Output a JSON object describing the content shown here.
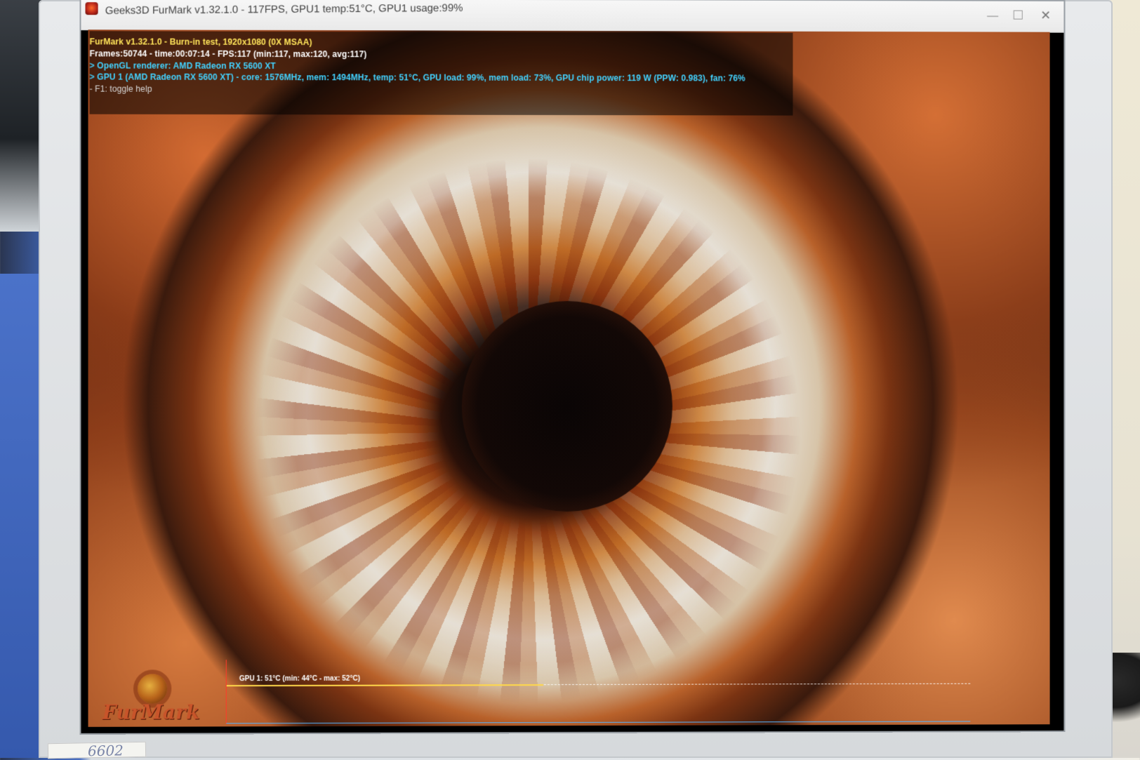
{
  "window": {
    "title": "Geeks3D FurMark v1.32.1.0 - 117FPS, GPU1 temp:51°C, GPU1 usage:99%",
    "minimize_glyph": "—",
    "maximize_glyph": "☐",
    "close_glyph": "✕"
  },
  "hud": {
    "line1": "FurMark v1.32.1.0 - Burn-in test, 1920x1080 (0X MSAA)",
    "line2": "Frames:50744 - time:00:07:14 - FPS:117 (min:117, max:120, avg:117)",
    "line3": "> OpenGL renderer: AMD Radeon RX 5600 XT",
    "line4": "> GPU 1 (AMD Radeon RX 5600 XT) - core: 1576MHz, mem: 1494MHz, temp: 51°C, GPU load: 99%, mem load: 73%, GPU chip power: 119 W (PPW: 0.983), fan: 76%",
    "line5": "- F1: toggle help"
  },
  "graph": {
    "label": "GPU 1: 51°C (min: 44°C - max: 52°C)"
  },
  "logo": {
    "text": "FurMark"
  },
  "sticker": {
    "text": "6602"
  },
  "colors": {
    "hud_title": "#ffe45a",
    "hud_info": "#42d2ff",
    "graph_line": "#ffd84a"
  }
}
